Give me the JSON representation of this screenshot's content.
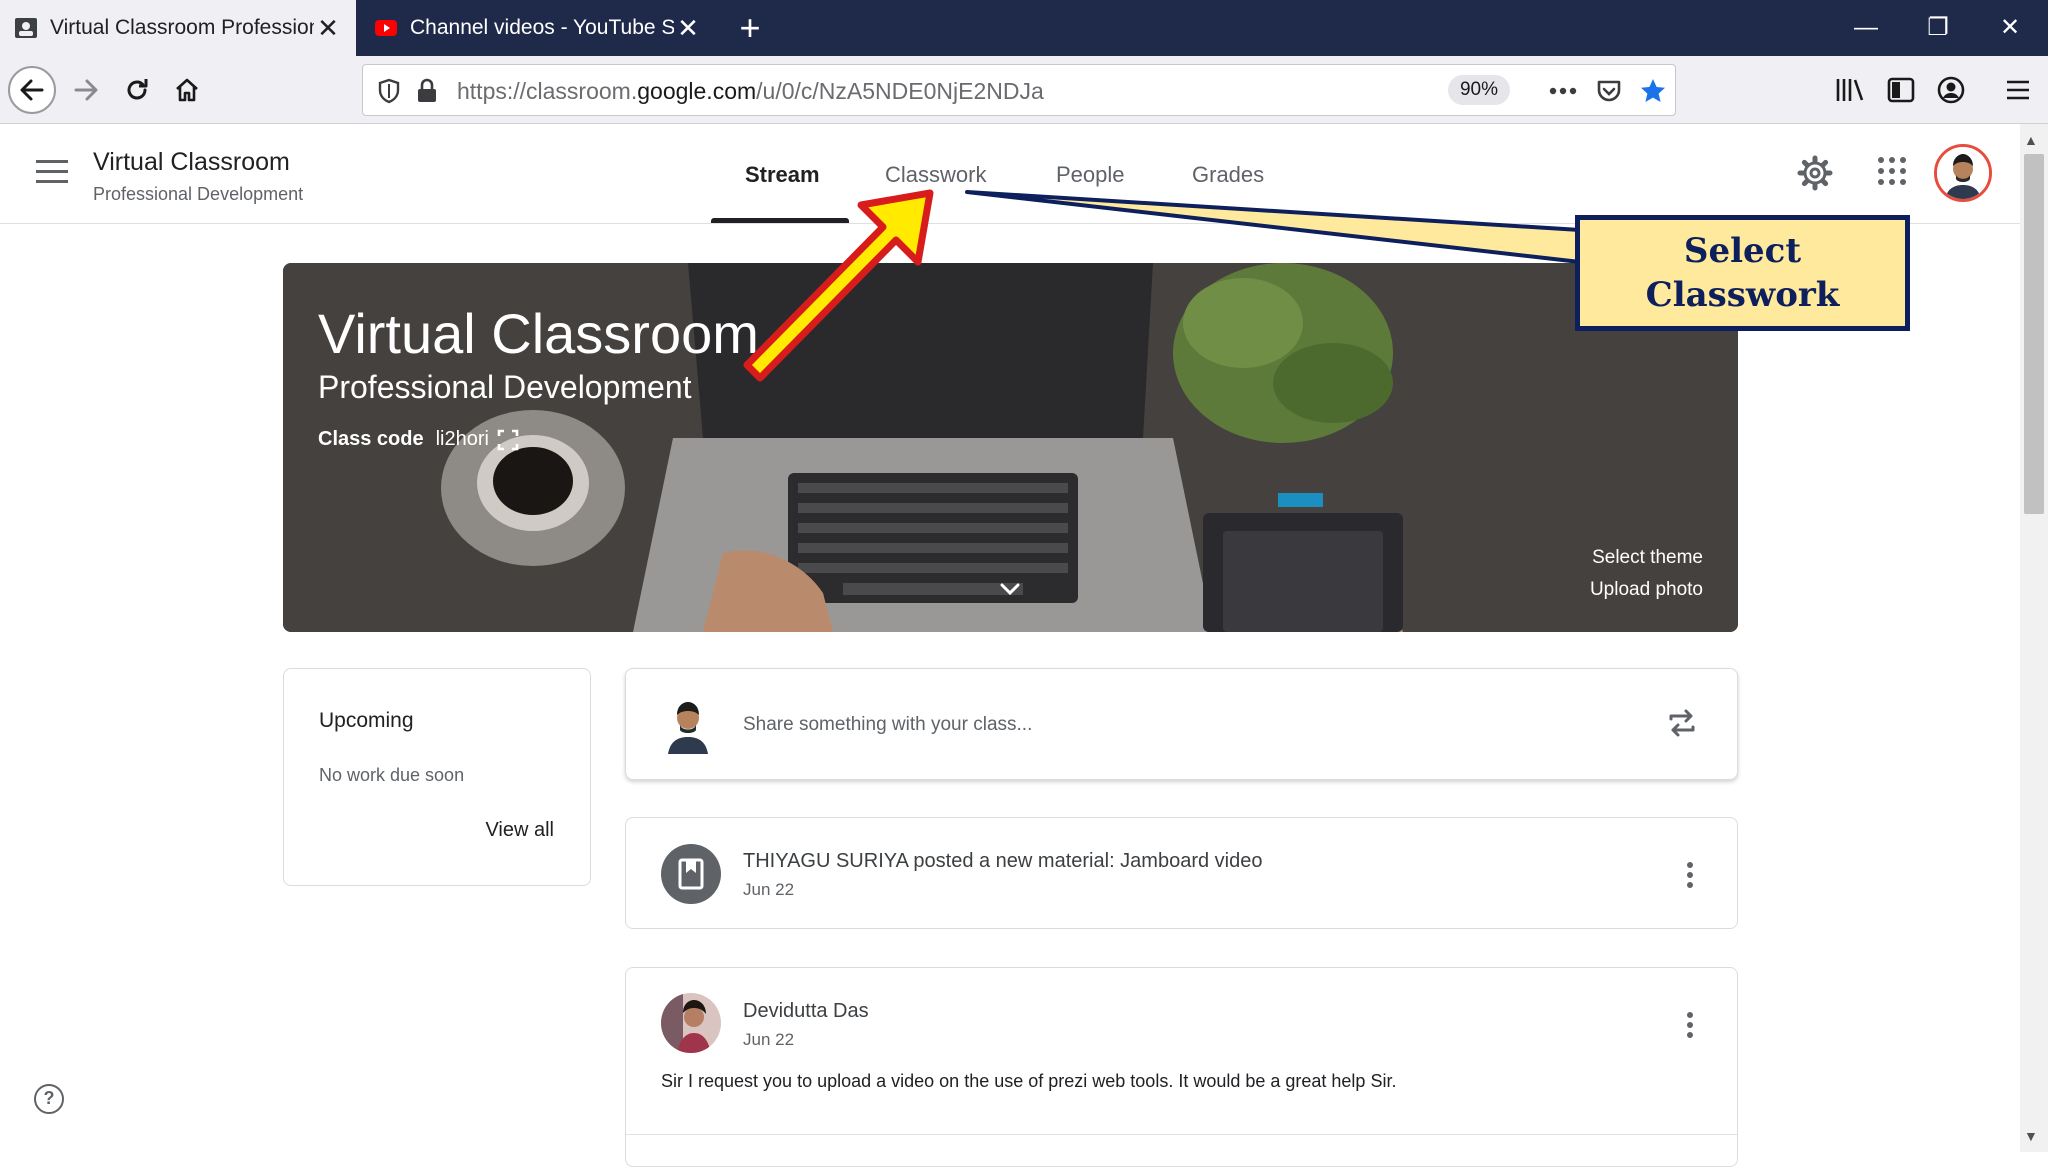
{
  "browser": {
    "tabs": [
      {
        "title": "Virtual Classroom Professional",
        "active": true
      },
      {
        "title": "Channel videos - YouTube Studio",
        "active": false
      }
    ],
    "url_prefix": "https://classroom.",
    "url_domain": "google.com",
    "url_path": "/u/0/c/NzA5NDE0NjE2NDJa",
    "zoom": "90%"
  },
  "classroom": {
    "title": "Virtual Classroom",
    "subtitle": "Professional Development",
    "nav_tabs": [
      "Stream",
      "Classwork",
      "People",
      "Grades"
    ],
    "selected_tab": "Stream"
  },
  "banner": {
    "title": "Virtual Classroom",
    "subtitle": "Professional Development",
    "class_code_label": "Class code",
    "class_code": "li2hori",
    "select_theme": "Select theme",
    "upload_photo": "Upload photo"
  },
  "upcoming": {
    "title": "Upcoming",
    "empty_text": "No work due soon",
    "view_all": "View all"
  },
  "share": {
    "placeholder": "Share something with your class..."
  },
  "posts": [
    {
      "author": "THIYAGU SURIYA posted a new material: Jamboard video",
      "date": "Jun 22",
      "body": ""
    },
    {
      "author": "Devidutta Das",
      "date": "Jun 22",
      "body": "Sir I request you to upload a video on the use of prezi web tools. It would be a great help Sir."
    }
  ],
  "annotation": {
    "line1": "Select",
    "line2": "Classwork"
  },
  "colors": {
    "tabbar": "#1f2a4a",
    "arrow_fill": "#ffea00",
    "arrow_outline": "#d81b1b",
    "callout_bg": "#ffe99c",
    "callout_border": "#0d1f5c"
  },
  "icons": [
    "back-icon",
    "forward-icon",
    "reload-icon",
    "home-icon",
    "shield-icon",
    "lock-icon",
    "more-icon",
    "pocket-icon",
    "star-icon",
    "library-icon",
    "sidebar-icon",
    "account-icon",
    "menu-icon",
    "gear-icon",
    "apps-icon",
    "fullscreen-icon",
    "expand-icon",
    "repost-icon",
    "material-icon",
    "kebab-icon",
    "help-icon"
  ]
}
